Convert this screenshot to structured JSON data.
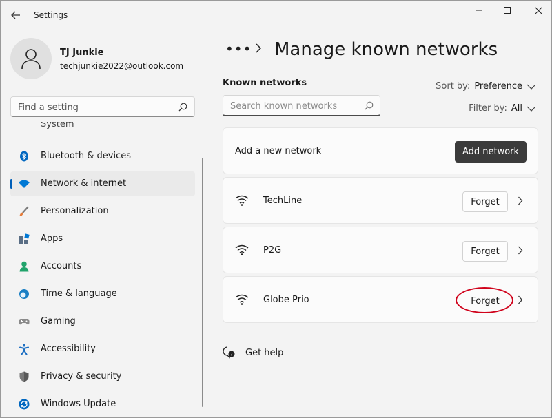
{
  "window": {
    "title": "Settings"
  },
  "profile": {
    "name": "TJ Junkie",
    "email": "techjunkie2022@outlook.com"
  },
  "search": {
    "placeholder": "Find a setting"
  },
  "nav": {
    "partial_label": "System",
    "items": [
      {
        "label": "Bluetooth & devices",
        "icon": "bluetooth-icon",
        "color": "#0067c0"
      },
      {
        "label": "Network & internet",
        "icon": "wifi-icon",
        "color": "#0078d4",
        "selected": true
      },
      {
        "label": "Personalization",
        "icon": "brush-icon",
        "color": "#e57c3a"
      },
      {
        "label": "Apps",
        "icon": "apps-icon",
        "color": "#5a6e85"
      },
      {
        "label": "Accounts",
        "icon": "person-icon",
        "color": "#21a36b"
      },
      {
        "label": "Time & language",
        "icon": "globe-clock-icon",
        "color": "#1a7fc4"
      },
      {
        "label": "Gaming",
        "icon": "gamepad-icon",
        "color": "#7a7a7a"
      },
      {
        "label": "Accessibility",
        "icon": "accessibility-icon",
        "color": "#1b6ec2"
      },
      {
        "label": "Privacy & security",
        "icon": "shield-icon",
        "color": "#6b6b6b"
      },
      {
        "label": "Windows Update",
        "icon": "update-icon",
        "color": "#0067c0"
      }
    ]
  },
  "breadcrumb": {
    "ellipsis": "•••",
    "page_title": "Manage known networks"
  },
  "known_networks": {
    "section_label": "Known networks",
    "search_placeholder": "Search known networks",
    "sort_prefix": "Sort by:",
    "sort_value": "Preference",
    "filter_prefix": "Filter by:",
    "filter_value": "All",
    "add_label": "Add a new network",
    "add_button": "Add network",
    "networks": [
      {
        "ssid": "TechLine",
        "forget_label": "Forget"
      },
      {
        "ssid": "P2G",
        "forget_label": "Forget"
      },
      {
        "ssid": "Globe Prio",
        "forget_label": "Forget",
        "highlighted": true
      }
    ]
  },
  "help": {
    "label": "Get help"
  },
  "colors": {
    "accent": "#005fb8",
    "annotation": "#d0021b",
    "primary_button": "#3b3b3b"
  }
}
